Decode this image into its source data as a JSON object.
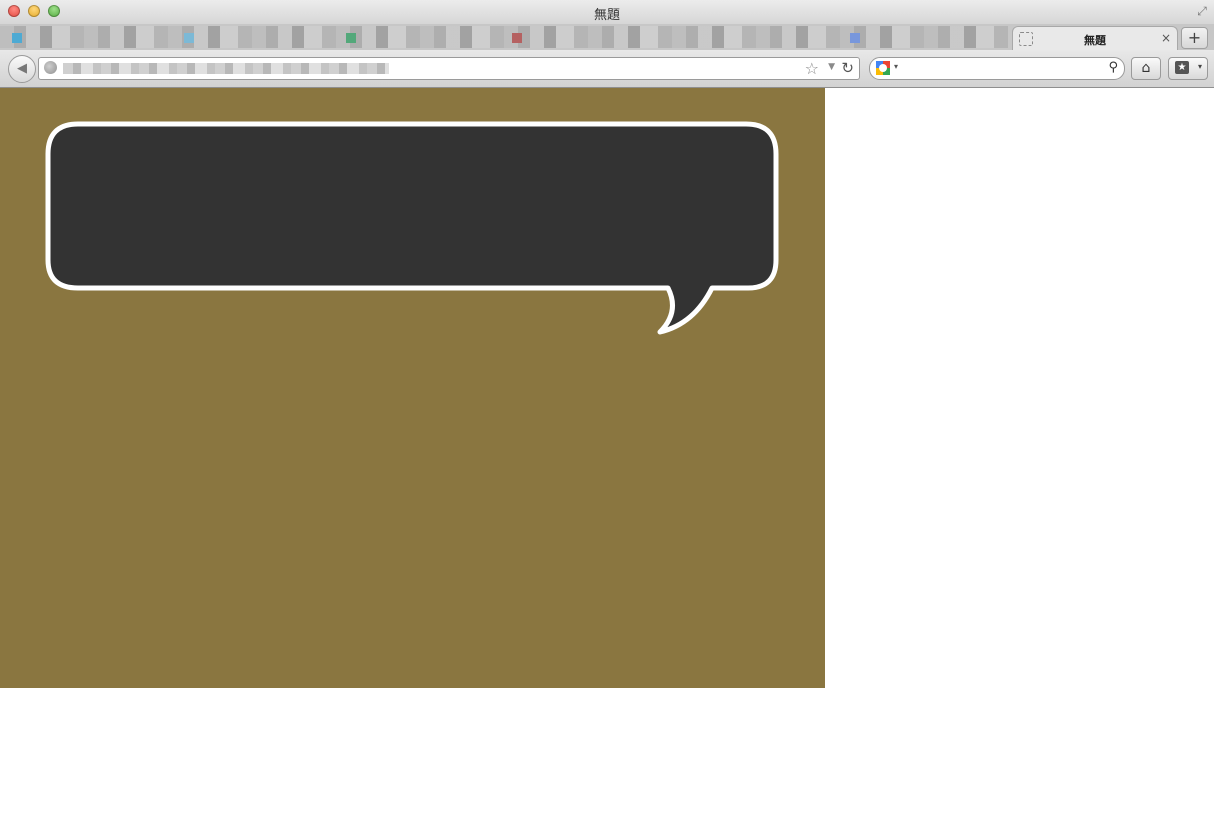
{
  "window": {
    "title": "無題"
  },
  "tabs": {
    "active_label": "無題",
    "close_glyph": "×",
    "new_tab_glyph": "+"
  },
  "toolbar": {
    "back_glyph": "◀",
    "star_glyph": "☆",
    "dropdown_glyph": "▼",
    "reload_glyph": "↻",
    "search_value": "",
    "search_glyph": "⚲",
    "home_glyph": "⌂",
    "bookmarks_glyph": "★",
    "caret_glyph": "▾"
  },
  "page": {
    "stage_color": "#8a7640",
    "bubble_fill": "#333333",
    "bubble_stroke": "#ffffff"
  }
}
